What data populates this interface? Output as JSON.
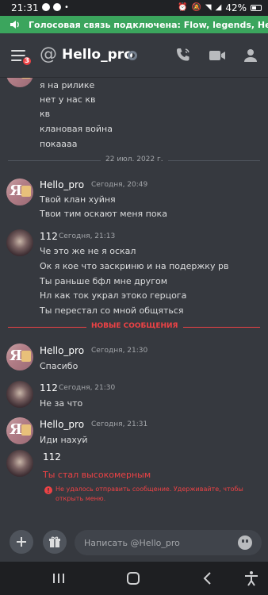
{
  "status_bar": {
    "time": "21:31",
    "battery": "42%"
  },
  "voice_banner": {
    "text": "Голосовая связь подключена: Flow, legends, Hello_..."
  },
  "header": {
    "at_symbol": "@",
    "title": "Hello_pro",
    "badge_count": "3"
  },
  "previous_messages": [
    "я на рилике",
    "нет у нас кв",
    "кв",
    "клановая война",
    "покаааа"
  ],
  "date_divider": "22 июл. 2022 г.",
  "groups": [
    {
      "author": "Hello_pro",
      "timestamp": "Сегодня, 20:49",
      "lines": [
        "Твой клан хуйня",
        "Твои тим оскают меня пока"
      ]
    },
    {
      "author": "112",
      "timestamp": "Сегодня, 21:13",
      "lines": [
        "Че это же не я оскал",
        "Ок я кое что заскриню и на подержку рв",
        "Ты раньше бфл мне другом",
        "Нл как ток украл этоко герцога",
        "Ты перестал со мной общяться"
      ]
    },
    {
      "author": "Hello_pro",
      "timestamp": "Сегодня, 21:30",
      "lines": [
        "Спасибо"
      ]
    },
    {
      "author": "112",
      "timestamp": "Сегодня, 21:30",
      "lines": [
        "Не за что"
      ]
    },
    {
      "author": "Hello_pro",
      "timestamp": "Сегодня, 21:31",
      "lines": [
        "Иди нахуй"
      ]
    },
    {
      "author": "112",
      "timestamp": "",
      "lines": [
        "Ты стал высокомерным"
      ]
    }
  ],
  "new_messages_label": "НОВЫЕ СООБЩЕНИЯ",
  "send_error": "Не удалось отправить сообщение. Удерживайте, чтобы открыть меню.",
  "composer": {
    "placeholder": "Написать @Hello_pro"
  },
  "colors": {
    "background": "#36393f",
    "voice_green": "#3ba55d",
    "error_red": "#ed4245",
    "badge_red": "#ed4245"
  }
}
